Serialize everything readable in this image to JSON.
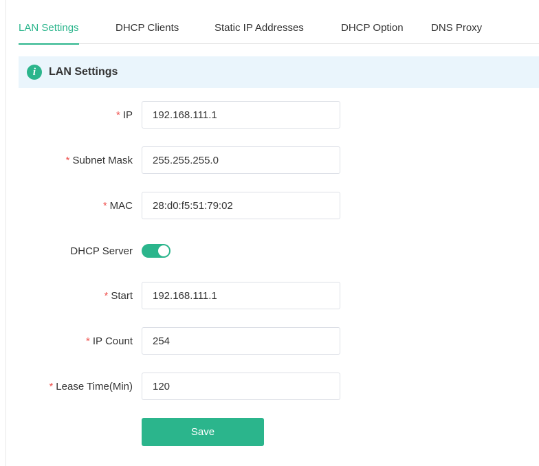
{
  "tabs": [
    {
      "label": "LAN Settings",
      "active": true
    },
    {
      "label": "DHCP Clients",
      "active": false
    },
    {
      "label": "Static IP Addresses",
      "active": false
    },
    {
      "label": "DHCP Option",
      "active": false
    },
    {
      "label": "DNS Proxy",
      "active": false
    }
  ],
  "section": {
    "icon": "info-icon",
    "title": "LAN Settings"
  },
  "form": {
    "ip": {
      "label": "IP",
      "required": true,
      "value": "192.168.111.1"
    },
    "subnet_mask": {
      "label": "Subnet Mask",
      "required": true,
      "value": "255.255.255.0"
    },
    "mac": {
      "label": "MAC",
      "required": true,
      "value": "28:d0:f5:51:79:02"
    },
    "dhcp_server": {
      "label": "DHCP Server",
      "enabled": true
    },
    "start": {
      "label": "Start",
      "required": true,
      "value": "192.168.111.1"
    },
    "ip_count": {
      "label": "IP Count",
      "required": true,
      "value": "254"
    },
    "lease_time": {
      "label": "Lease Time(Min)",
      "required": true,
      "value": "120"
    },
    "required_mark": "*"
  },
  "actions": {
    "save_label": "Save"
  },
  "colors": {
    "accent": "#2bb58c",
    "info_bg": "#eaf5fc",
    "required": "#ef5350"
  }
}
